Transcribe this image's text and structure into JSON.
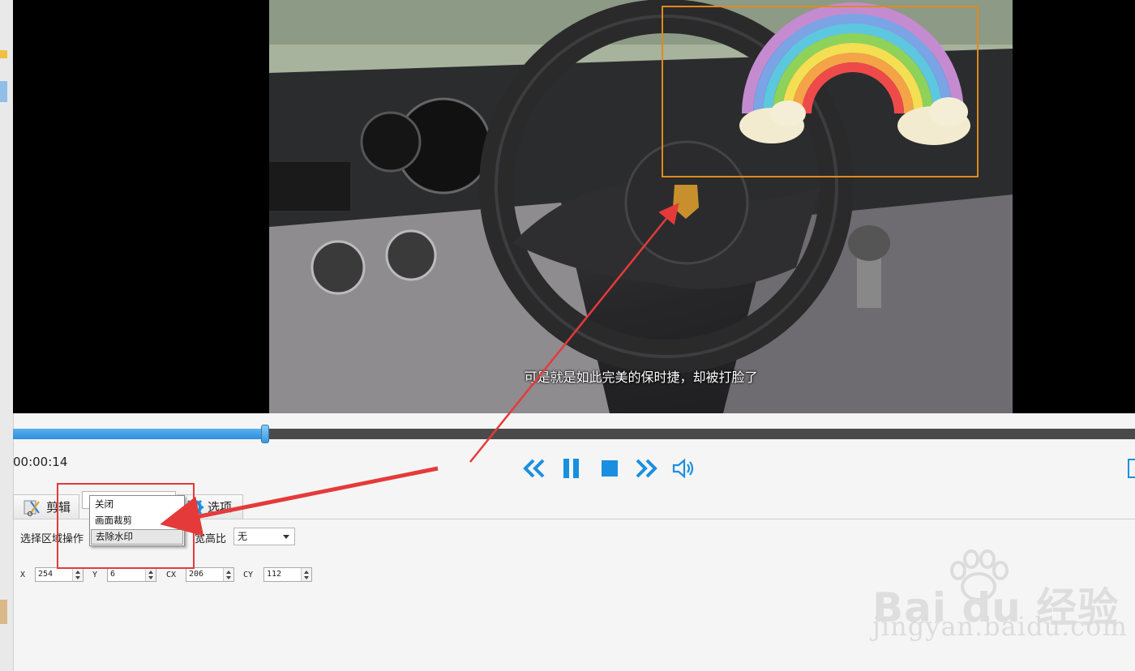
{
  "player": {
    "subtitle": "可是就是如此完美的保时捷，却被打脸了",
    "time": "00:00:14",
    "progress_fraction": 0.225
  },
  "controls": {
    "rewind_icon": "double-chevron-left-icon",
    "pause_icon": "pause-icon",
    "stop_icon": "stop-icon",
    "forward_icon": "double-chevron-right-icon",
    "volume_icon": "volume-icon",
    "accent": "#1a8fe0"
  },
  "tabs": {
    "edit_label": "剪辑",
    "options_label": "选项"
  },
  "region": {
    "op_label": "选择区域操作",
    "aspect_label": "宽高比",
    "aspect_value": "无"
  },
  "dropdown": {
    "items": [
      "关闭",
      "画面裁剪",
      "去除水印"
    ],
    "selected_index": 2
  },
  "coords": {
    "x_label": "X",
    "x_value": "254",
    "y_label": "Y",
    "y_value": "6",
    "cx_label": "CX",
    "cx_value": "206",
    "cy_label": "CY",
    "cy_value": "112"
  },
  "watermark": {
    "brand": "Bai du 经验",
    "url": "jingyan.baidu.com"
  },
  "colors": {
    "selection_box": "#e08a1a",
    "annotation_red": "#e53a3a"
  }
}
